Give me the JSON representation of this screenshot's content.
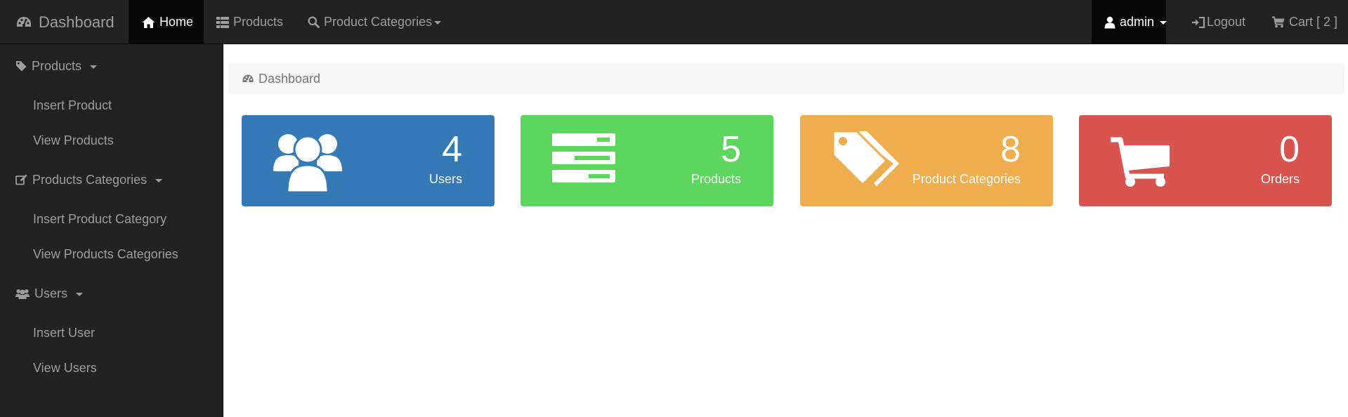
{
  "navbar": {
    "brand": "Dashboard",
    "items": [
      {
        "label": "Home",
        "icon": "home-icon",
        "active": true
      },
      {
        "label": "Products",
        "icon": "list-icon"
      },
      {
        "label": "Product Categories",
        "icon": "search-icon",
        "dropdown": true
      }
    ],
    "right": [
      {
        "label": "admin",
        "icon": "user-icon",
        "dropdown": true
      },
      {
        "label": "Logout",
        "icon": "log-in-icon"
      },
      {
        "label": "Cart [ 2 ]",
        "icon": "shopping-cart-icon"
      }
    ]
  },
  "sidebar": {
    "groups": [
      {
        "label": "Products",
        "icon": "tag-icon",
        "items": [
          "Insert Product",
          "View Products"
        ]
      },
      {
        "label": "Products Categories",
        "icon": "edit-icon",
        "items": [
          "Insert Product Category",
          "View Products Categories"
        ]
      },
      {
        "label": "Users",
        "icon": "users-icon",
        "items": [
          "Insert User",
          "View Users"
        ]
      }
    ]
  },
  "breadcrumb": {
    "label": "Dashboard",
    "icon": "dashboard-icon"
  },
  "panels": [
    {
      "count": "4",
      "label": "Users",
      "color": "#337ab7",
      "icon": "users-icon"
    },
    {
      "count": "5",
      "label": "Products",
      "color": "#5cd65c",
      "icon": "server-icon"
    },
    {
      "count": "8",
      "label": "Product Categories",
      "color": "#f0ad4e",
      "icon": "tags-icon"
    },
    {
      "count": "0",
      "label": "Orders",
      "color": "#d9534f",
      "icon": "shopping-cart-icon"
    }
  ]
}
